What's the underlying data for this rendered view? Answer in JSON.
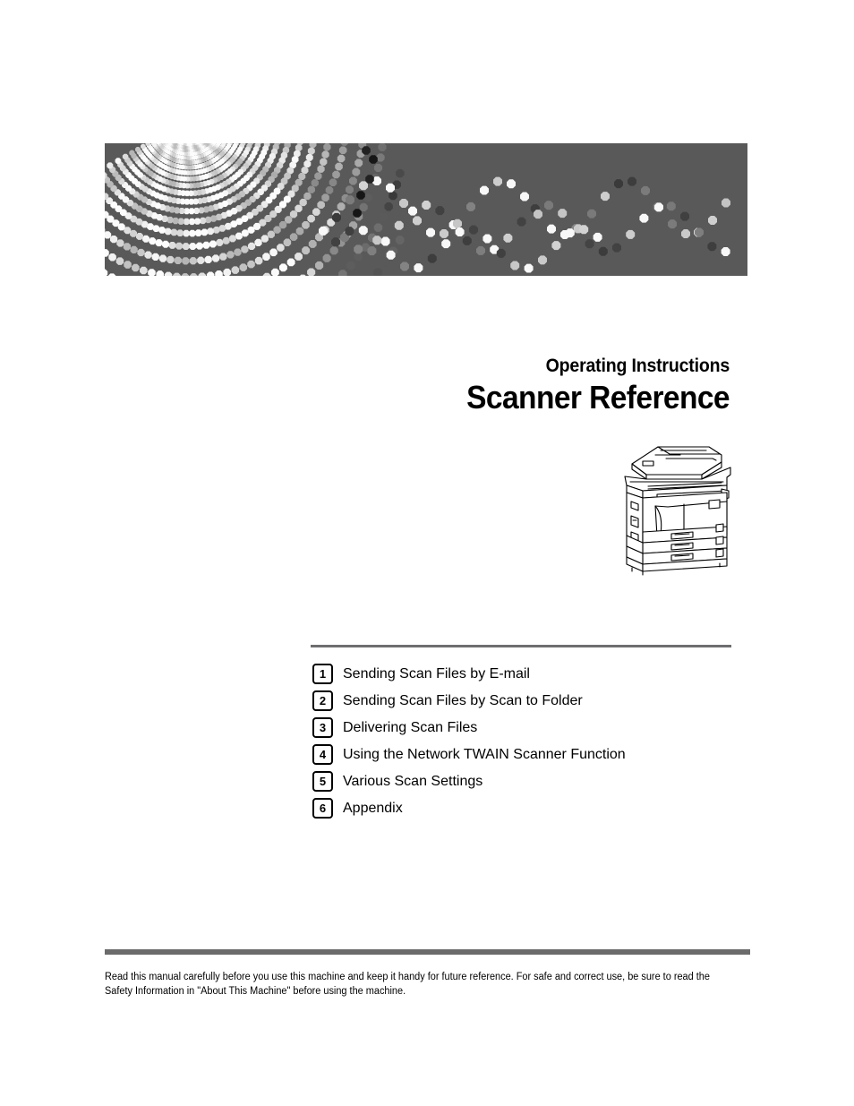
{
  "document": {
    "series_label": "Operating Instructions",
    "title": "Scanner Reference"
  },
  "banner": {
    "background_color": "#59595a",
    "motif": "halftone-dot-burst-and-wave"
  },
  "illustration": {
    "name": "multifunction-copier-printer-line-art"
  },
  "chapters": [
    {
      "number": "1",
      "label": "Sending Scan Files by E-mail"
    },
    {
      "number": "2",
      "label": "Sending Scan Files by Scan to Folder"
    },
    {
      "number": "3",
      "label": "Delivering Scan Files"
    },
    {
      "number": "4",
      "label": "Using the Network TWAIN Scanner Function"
    },
    {
      "number": "5",
      "label": "Various Scan Settings"
    },
    {
      "number": "6",
      "label": "Appendix"
    }
  ],
  "footer": {
    "notice": "Read this manual carefully before you use this machine and keep it handy for future reference. For safe and correct use, be sure to read the Safety Information in \"About This Machine\" before using the machine.",
    "rule_color": "#6b6b6b"
  }
}
